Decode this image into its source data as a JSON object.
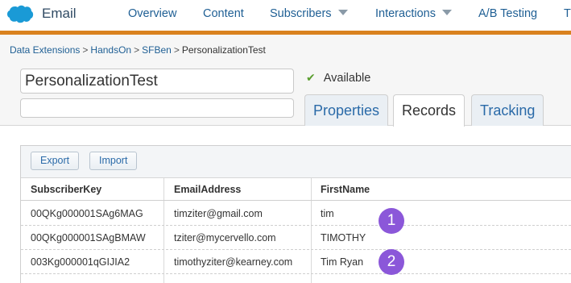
{
  "nav": {
    "app_name": "Email",
    "items": [
      "Overview",
      "Content",
      "Subscribers",
      "Interactions",
      "A/B Testing",
      "T"
    ],
    "accent_color": "#d9821f",
    "logo_icon": "salesforce-cloud-icon"
  },
  "breadcrumb": {
    "items": [
      "Data Extensions",
      "HandsOn",
      "SFBen"
    ],
    "separator": ">",
    "current": "PersonalizationTest"
  },
  "data_extension": {
    "name_value": "PersonalizationTest",
    "description_value": "",
    "status": "Available",
    "status_icon": "check-icon"
  },
  "tabs": [
    "Properties",
    "Records",
    "Tracking"
  ],
  "active_tab": "Records",
  "toolbar": {
    "export_label": "Export",
    "import_label": "Import"
  },
  "table": {
    "columns": [
      "SubscriberKey",
      "EmailAddress",
      "FirstName"
    ],
    "rows": [
      [
        "00QKg000001SAg6MAG",
        "timziter@gmail.com",
        "tim"
      ],
      [
        "00QKg000001SAgBMAW",
        "tziter@mycervello.com",
        "TIMOTHY"
      ],
      [
        "003Kg000001qGIJIA2",
        "timothyziter@kearney.com",
        "Tim Ryan"
      ]
    ]
  },
  "annotations": [
    "1",
    "2"
  ],
  "annotation_color": "#8b57d9"
}
